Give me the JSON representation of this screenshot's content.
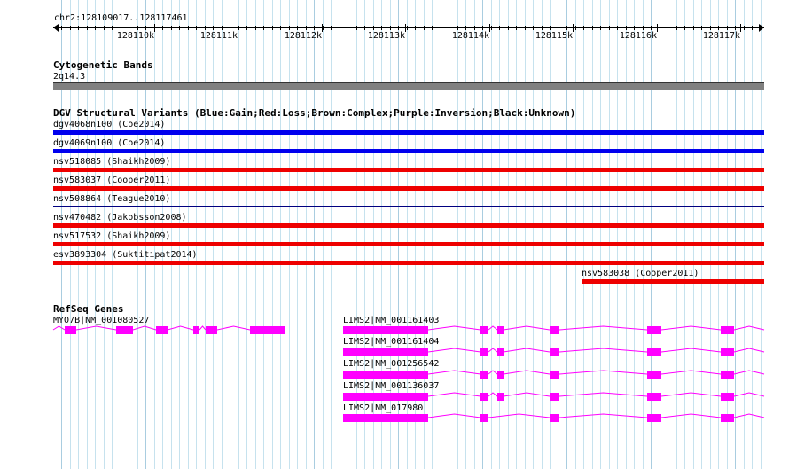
{
  "ruler": {
    "location": "chr2:128109017..128117461",
    "ticks": [
      "128110k",
      "128111k",
      "128112k",
      "128113k",
      "128114k",
      "128115k",
      "128116k",
      "128117k"
    ]
  },
  "cytoband": {
    "title": "Cytogenetic Bands",
    "band_name": "2q14.3",
    "band_color": "#808080"
  },
  "dgv": {
    "title": "DGV Structural Variants (Blue:Gain;Red:Loss;Brown:Complex;Purple:Inversion;Black:Unknown)",
    "colors": {
      "gain": "#0000ee",
      "loss": "#ee0000",
      "unknown": "#000080"
    },
    "variants": [
      {
        "label": "dgv4068n100 (Coe2014)",
        "type": "gain"
      },
      {
        "label": "dgv4069n100 (Coe2014)",
        "type": "gain"
      },
      {
        "label": "nsv518085 (Shaikh2009)",
        "type": "loss"
      },
      {
        "label": "nsv583037 (Cooper2011)",
        "type": "loss"
      },
      {
        "label": "nsv508864 (Teague2010)",
        "type": "unknown"
      },
      {
        "label": "nsv470482 (Jakobsson2008)",
        "type": "loss"
      },
      {
        "label": "nsv517532 (Shaikh2009)",
        "type": "loss"
      },
      {
        "label": "esv3893304 (Suktitipat2014)",
        "type": "loss"
      },
      {
        "label": "nsv583038 (Cooper2011)",
        "type": "loss"
      }
    ]
  },
  "refseq": {
    "title": "RefSeq Genes",
    "color": "#ff00ff",
    "genes": [
      {
        "label": "MYO7B|NM_001080527"
      },
      {
        "label": "LIMS2|NM_001161403"
      },
      {
        "label": "LIMS2|NM_001161404"
      },
      {
        "label": "LIMS2|NM_001256542"
      },
      {
        "label": "LIMS2|NM_001136037"
      },
      {
        "label": "LIMS2|NM_017980"
      }
    ]
  }
}
